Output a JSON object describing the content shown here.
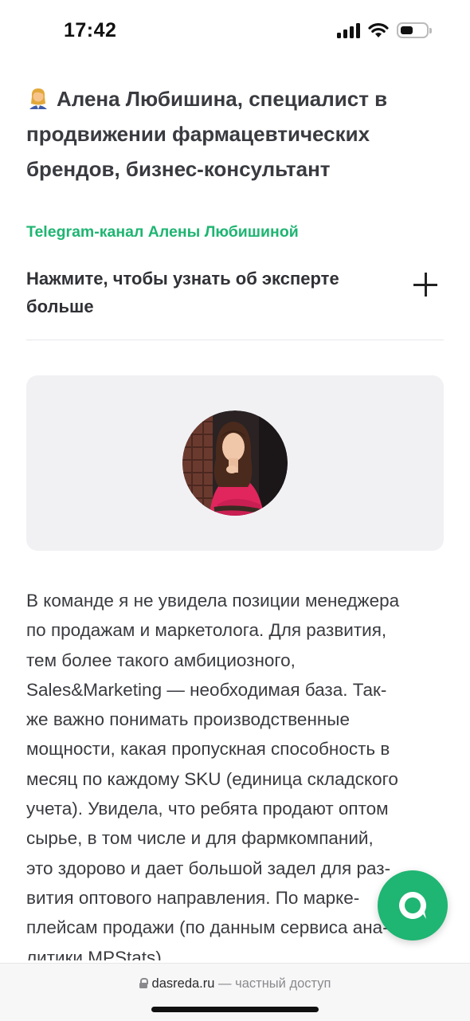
{
  "status_bar": {
    "time": "17:42",
    "battery_level": 0.5
  },
  "article": {
    "expert_headline": "Алена Любишина, специалист в продвижении фармацевтических брендов, бизнес-консультант",
    "channel_link": "Telegram-канал Алены Любишиной",
    "expander_label": "Нажмите, чтобы узнать об эксперте больше",
    "body_text": "В команде я не увидела позиции менеджера\nпо продажам и маркетолога. Для развития,\nтем более такого амбициозного,\nSales&Marketing — необходимая база. Так-\nже важно понимать производственные\nмощности, какая пропускная способность в\nмесяц по каждому SKU (единица складского\nучета). Увидела, что ребята продают оптом\nсырье, в том числе и для фармкомпаний,\nэто здорово и дает большой задел для раз-\nвития оптового направления. По марке-\nплейсам продажи (по данным сервиса ана-\nлитики MPStats)..."
  },
  "browser": {
    "domain": "dasreda.ru",
    "access_note": "— частный доступ"
  },
  "colors": {
    "accent": "#1fb572",
    "card_bg": "#f1f1f4",
    "text": "#3a3b40"
  }
}
